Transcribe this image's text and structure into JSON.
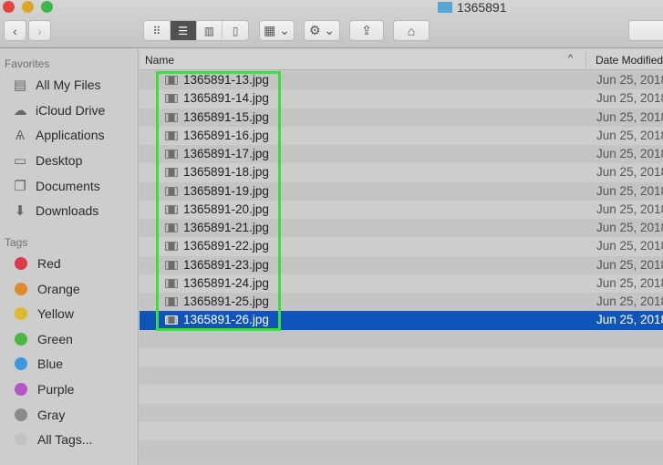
{
  "window": {
    "title": "1365891"
  },
  "toolbar": {
    "back_icon": "‹",
    "forward_icon": "›",
    "view_modes": [
      {
        "name": "icon-view",
        "glyph": "⠿",
        "active": false
      },
      {
        "name": "list-view",
        "glyph": "☰",
        "active": true
      },
      {
        "name": "column-view",
        "glyph": "▥",
        "active": false
      },
      {
        "name": "cover-flow-view",
        "glyph": "▯",
        "active": false
      }
    ],
    "arrange_glyph": "▦ ⌄",
    "action_glyph": "⚙ ⌄",
    "share_glyph": "⇪",
    "tags_glyph": "⌂"
  },
  "sidebar": {
    "favorites_heading": "Favorites",
    "favorites": [
      {
        "label": "All My Files",
        "icon": "all-my-files-icon",
        "glyph": "▤"
      },
      {
        "label": "iCloud Drive",
        "icon": "icloud-icon",
        "glyph": "☁"
      },
      {
        "label": "Applications",
        "icon": "applications-icon",
        "glyph": "Ѧ"
      },
      {
        "label": "Desktop",
        "icon": "desktop-icon",
        "glyph": "▭"
      },
      {
        "label": "Documents",
        "icon": "documents-icon",
        "glyph": "❐"
      },
      {
        "label": "Downloads",
        "icon": "downloads-icon",
        "glyph": "⬇"
      }
    ],
    "tags_heading": "Tags",
    "tags": [
      {
        "label": "Red",
        "color": "#e0394a"
      },
      {
        "label": "Orange",
        "color": "#e08a2e"
      },
      {
        "label": "Yellow",
        "color": "#e0b92e"
      },
      {
        "label": "Green",
        "color": "#4cb840"
      },
      {
        "label": "Blue",
        "color": "#3b98dc"
      },
      {
        "label": "Purple",
        "color": "#b455c8"
      },
      {
        "label": "Gray",
        "color": "#8a8a8a"
      },
      {
        "label": "All Tags...",
        "color": "#c2c2c2"
      }
    ]
  },
  "list": {
    "columns": {
      "name": "Name",
      "date": "Date Modified",
      "sort_indicator": "^"
    },
    "files": [
      {
        "name": "1365891-13.jpg",
        "date": "Jun 25, 2018",
        "selected": false
      },
      {
        "name": "1365891-14.jpg",
        "date": "Jun 25, 2018",
        "selected": false
      },
      {
        "name": "1365891-15.jpg",
        "date": "Jun 25, 2018",
        "selected": false
      },
      {
        "name": "1365891-16.jpg",
        "date": "Jun 25, 2018",
        "selected": false
      },
      {
        "name": "1365891-17.jpg",
        "date": "Jun 25, 2018",
        "selected": false
      },
      {
        "name": "1365891-18.jpg",
        "date": "Jun 25, 2018",
        "selected": false
      },
      {
        "name": "1365891-19.jpg",
        "date": "Jun 25, 2018",
        "selected": false
      },
      {
        "name": "1365891-20.jpg",
        "date": "Jun 25, 2018",
        "selected": false
      },
      {
        "name": "1365891-21.jpg",
        "date": "Jun 25, 2018",
        "selected": false
      },
      {
        "name": "1365891-22.jpg",
        "date": "Jun 25, 2018",
        "selected": false
      },
      {
        "name": "1365891-23.jpg",
        "date": "Jun 25, 2018",
        "selected": false
      },
      {
        "name": "1365891-24.jpg",
        "date": "Jun 25, 2018",
        "selected": false
      },
      {
        "name": "1365891-25.jpg",
        "date": "Jun 25, 2018",
        "selected": false
      },
      {
        "name": "1365891-26.jpg",
        "date": "Jun 25, 2018",
        "selected": true
      }
    ],
    "empty_rows": 7
  },
  "colors": {
    "selection": "#0f54b9",
    "highlight_box": "#39e03c"
  }
}
